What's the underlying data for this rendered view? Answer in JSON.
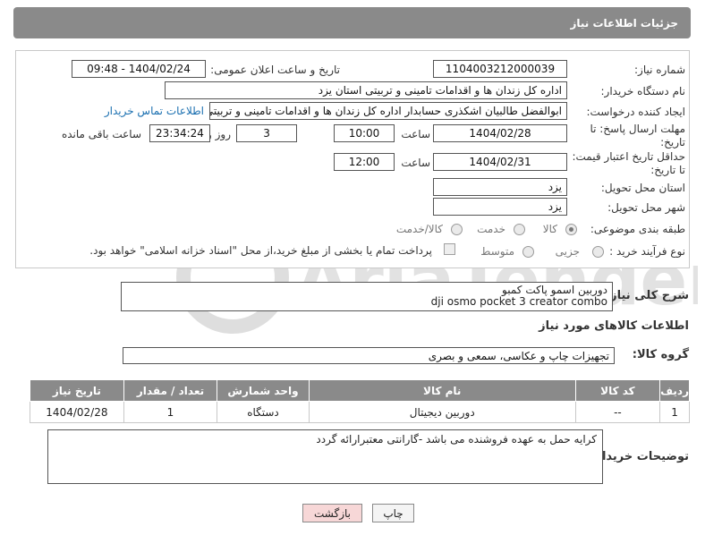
{
  "header": {
    "title": "جزئیات اطلاعات نیاز"
  },
  "form": {
    "need_number_label": "شماره نیاز:",
    "need_number": "1104003212000039",
    "announce_label": "تاریخ و ساعت اعلان عمومی:",
    "announce_value": "1404/02/24 - 09:48",
    "buyer_org_label": "نام دستگاه خریدار:",
    "buyer_org": "اداره کل زندان ها و اقدامات تامینی و تربیتی استان یزد",
    "creator_label": "ایجاد کننده درخواست:",
    "creator": "ابوالفضل  طالبیان اشکذری حسابدار اداره کل زندان ها و اقدامات تامینی و تربیتی استان یزد",
    "contact_link": "اطلاعات تماس خریدار",
    "deadline_label_1": "مهلت ارسال پاسخ: تا",
    "deadline_label_2": "تاریخ:",
    "deadline_date": "1404/02/28",
    "time_label": "ساعت",
    "deadline_time": "10:00",
    "days_value": "3",
    "days_label": "روز و",
    "remaining_time": "23:34:24",
    "remaining_label": "ساعت باقی مانده",
    "min_validity_label_1": "حداقل تاریخ اعتبار قیمت:",
    "min_validity_label_2": "تا تاریخ:",
    "validity_date": "1404/02/31",
    "validity_time_label": "ساعت",
    "validity_time": "12:00",
    "province_label": "استان محل تحویل:",
    "province": "یزد",
    "city_label": "شهر محل تحویل:",
    "city": "یزد",
    "category_label": "طبقه بندی موضوعی:",
    "category_options": [
      "کالا",
      "خدمت",
      "کالا/خدمت"
    ],
    "process_label": "نوع فرآیند خرید :",
    "process_options": [
      "جزیی",
      "متوسط"
    ],
    "payment_note": "پرداخت تمام یا بخشی از مبلغ خرید،از محل \"اسناد خزانه اسلامی\" خواهد بود."
  },
  "summary": {
    "label": "شرح کلی نیاز:",
    "line1": "دوربین اسمو پاکت کمبو",
    "line2": "dji osmo pocket 3 creator combo"
  },
  "goods_info": {
    "title": "اطلاعات کالاهای مورد نیاز",
    "group_label": "گروه کالا:",
    "group_value": "تجهیزات چاپ و عکاسی، سمعی و بصری"
  },
  "table": {
    "headers": [
      "ردیف",
      "کد کالا",
      "نام کالا",
      "واحد شمارش",
      "تعداد / مقدار",
      "تاریخ نیاز"
    ],
    "rows": [
      [
        "1",
        "--",
        "دوربین دیجیتال",
        "دستگاه",
        "1",
        "1404/02/28"
      ]
    ]
  },
  "buyer_notes": {
    "label": "توضیحات خریدار:",
    "text": "کرایه حمل به عهده فروشنده می باشد -گارانتی معتبرارائه گردد"
  },
  "buttons": {
    "print": "چاپ",
    "back": "بازگشت"
  },
  "watermark": {
    "text": "AriaTender.neT"
  },
  "colors": {
    "header_bg": "#8a8a8a",
    "link": "#1a6fb0",
    "back_button_bg": "#f7d7d7"
  }
}
